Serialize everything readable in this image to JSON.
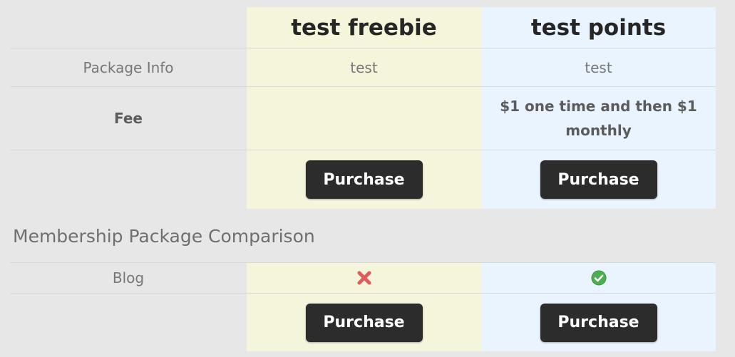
{
  "plans": [
    {
      "name": "test freebie",
      "package_info": "test",
      "fee": "",
      "purchase_label": "Purchase",
      "blog_included": false,
      "blog_icon": "red-x-icon"
    },
    {
      "name": "test points",
      "package_info": "test",
      "fee": "$1 one time and then $1 monthly",
      "purchase_label": "Purchase",
      "blog_included": true,
      "blog_icon": "green-check-icon"
    }
  ],
  "rows": {
    "package_info": "Package Info",
    "fee": "Fee",
    "blog": "Blog"
  },
  "section": {
    "comparison_title": "Membership Package Comparison"
  },
  "colors": {
    "freebie_column": "#f5f5dc",
    "points_column": "#eaf4fe",
    "button": "#2c2c2c",
    "cross": "#e25b5b",
    "check": "#4caf50"
  }
}
